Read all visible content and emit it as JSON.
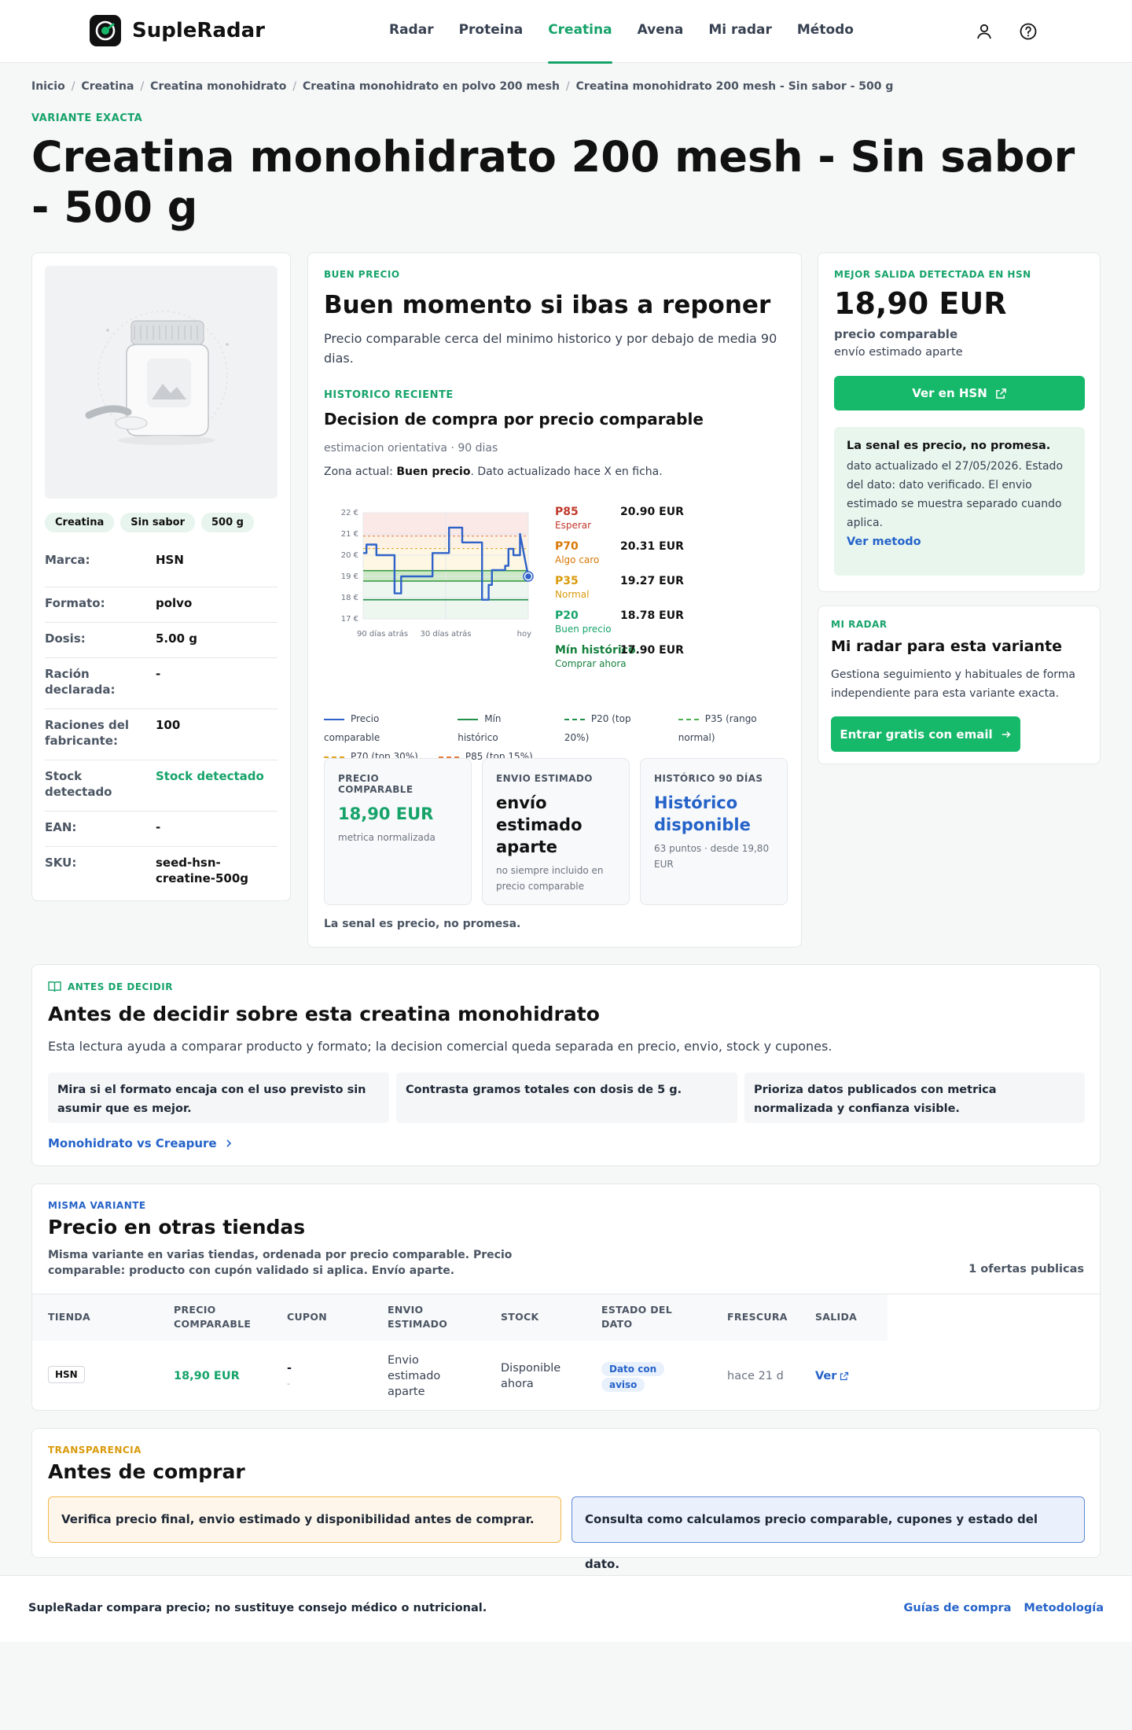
{
  "header": {
    "brand": "SupleRadar",
    "nav": [
      "Radar",
      "Proteina",
      "Creatina",
      "Avena",
      "Mi radar",
      "Método"
    ],
    "active_nav": "Creatina",
    "icons": [
      "user-icon",
      "help-icon"
    ]
  },
  "breadcrumb": [
    "Inicio",
    "Creatina",
    "Creatina monohidrato",
    "Creatina monohidrato en polvo 200 mesh",
    "Creatina monohidrato 200 mesh - Sin sabor - 500 g"
  ],
  "page": {
    "eyebrow": "VARIANTE EXACTA",
    "title": "Creatina monohidrato 200 mesh - Sin sabor - 500 g"
  },
  "product": {
    "chips": [
      "Creatina",
      "Sin sabor",
      "500 g"
    ],
    "specs": [
      {
        "k": "Marca:",
        "v": "HSN"
      },
      {
        "k": "Formato:",
        "v": "polvo"
      },
      {
        "k": "Dosis:",
        "v": "5.00 g"
      },
      {
        "k": "Ración declarada:",
        "v": "-"
      },
      {
        "k": "Raciones del fabricante:",
        "v": "100"
      },
      {
        "k": "Stock detectado",
        "v": "Stock detectado"
      },
      {
        "k": "EAN:",
        "v": "-"
      },
      {
        "k": "SKU:",
        "v": "seed-hsn-creatine-500g"
      }
    ]
  },
  "analysis": {
    "eyebrow": "BUEN PRECIO",
    "title": "Buen momento si ibas a reponer",
    "desc": "Precio comparable cerca del minimo historico y por debajo de media 90 dias.",
    "hist_eyebrow": "HISTORICO RECIENTE",
    "hist_title": "Decision de compra por precio comparable",
    "hist_meta": "estimacion orientativa · 90 dias",
    "zone_prefix": "Zona actual: ",
    "zone_value": "Buen precio",
    "zone_suffix": ". Dato actualizado hace X en ficha.",
    "footnote": "La senal es precio, no promesa.",
    "metrics": [
      {
        "label": "PRECIO COMPARABLE",
        "value": "18,90 EUR",
        "sub": "metrica normalizada"
      },
      {
        "label": "ENVIO ESTIMADO",
        "value": "envío estimado aparte",
        "sub": "no siempre incluido en precio comparable"
      },
      {
        "label": "HISTÓRICO 90 DÍAS",
        "value": "Histórico disponible",
        "sub": "63 puntos · desde 19,80 EUR"
      }
    ]
  },
  "chart_data": {
    "type": "line",
    "title": "",
    "x_ticks": [
      "90 días atrás",
      "30 días atrás",
      "hoy"
    ],
    "y_ticks": [
      "17 €",
      "18 €",
      "19 €",
      "20 €",
      "21 €",
      "22 €"
    ],
    "ylim": [
      17,
      22
    ],
    "series": [
      {
        "name": "Precio comparable",
        "color": "#2f62c9",
        "x": [
          0,
          2,
          2,
          8,
          8,
          19,
          19,
          23,
          23,
          42,
          42,
          52,
          52,
          60,
          60,
          72,
          72,
          76,
          76,
          78,
          78,
          86,
          86,
          88,
          88,
          91,
          91,
          95,
          95,
          100
        ],
        "y": [
          20.1,
          20.1,
          20.5,
          20.5,
          20.0,
          20.0,
          18.2,
          18.2,
          19.0,
          19.0,
          20.1,
          20.1,
          21.3,
          21.3,
          20.6,
          20.6,
          17.9,
          17.9,
          18.6,
          18.6,
          19.3,
          19.3,
          19.5,
          19.5,
          20.3,
          20.3,
          20.0,
          20.0,
          21.0,
          19.0
        ]
      },
      {
        "name": "Mín histórico",
        "color": "#1f8f4a",
        "value": 17.9
      },
      {
        "name": "P20 (top 20%)",
        "color": "#1f8f4a",
        "value": 18.78
      },
      {
        "name": "P35 (rango normal)",
        "color": "#4caf50",
        "value": 19.27
      },
      {
        "name": "P70 (top 30%)",
        "color": "#e0a020",
        "value": 20.31
      },
      {
        "name": "P85 (top 15%)",
        "color": "#e07a3a",
        "value": 20.9
      }
    ],
    "current_point": 19.0,
    "percentiles": [
      {
        "label": "P85",
        "note": "Esperar",
        "value": "20.90 EUR",
        "color": "#c0392b"
      },
      {
        "label": "P70",
        "note": "Algo caro",
        "value": "20.31 EUR",
        "color": "#d97706"
      },
      {
        "label": "P35",
        "note": "Normal",
        "value": "19.27 EUR",
        "color": "#d99a0b"
      },
      {
        "label": "P20",
        "note": "Buen precio",
        "value": "18.78 EUR",
        "color": "#16a36a"
      },
      {
        "label": "Mín histórico",
        "note": "Comprar ahora",
        "value": "17.90 EUR",
        "color": "#15803d"
      }
    ],
    "legend": [
      "Precio comparable",
      "Mín histórico",
      "P20 (top 20%)",
      "P35 (rango normal)",
      "P70 (top 30%)",
      "P85 (top 15%)"
    ]
  },
  "best_offer": {
    "eyebrow": "MEJOR SALIDA DETECTADA EN HSN",
    "price": "18,90 EUR",
    "label": "precio comparable",
    "shipping": "envío estimado aparte",
    "button": "Ver en HSN",
    "note_title": "La senal es precio, no promesa.",
    "note_body": "dato actualizado el 27/05/2026. Estado del dato: dato verificado. El envio estimado se muestra separado cuando aplica.",
    "note_link": "Ver metodo"
  },
  "my_radar": {
    "eyebrow": "MI RADAR",
    "title": "Mi radar para esta variante",
    "desc": "Gestiona seguimiento y habituales de forma independiente para esta variante exacta.",
    "button": "Entrar gratis con email"
  },
  "before": {
    "eyebrow": "ANTES DE DECIDIR",
    "title": "Antes de decidir sobre esta creatina monohidrato",
    "desc": "Esta lectura ayuda a comparar producto y formato; la decision comercial queda separada en precio, envio, stock y cupones.",
    "tips": [
      "Mira si el formato encaja con el uso previsto sin asumir que es mejor.",
      "Contrasta gramos totales con dosis de 5 g.",
      "Prioriza datos publicados con metrica normalizada y confianza visible."
    ],
    "link": "Monohidrato vs Creapure"
  },
  "stores": {
    "eyebrow": "MISMA VARIANTE",
    "title": "Precio en otras tiendas",
    "desc": "Misma variante en varias tiendas, ordenada por precio comparable. Precio comparable: producto con cupón validado si aplica. Envío aparte.",
    "count": "1 ofertas publicas",
    "columns": [
      "TIENDA",
      "PRECIO COMPARABLE",
      "CUPON",
      "ENVIO ESTIMADO",
      "STOCK",
      "ESTADO DEL DATO",
      "FRESCURA",
      "SALIDA"
    ],
    "rows": [
      {
        "store": "HSN",
        "price": "18,90 EUR",
        "coupon": "-",
        "coupon_sub": "-",
        "shipping": "Envio estimado aparte",
        "stock": "Disponible ahora",
        "status": "Dato con aviso",
        "freshness": "hace 21 d",
        "action": "Ver"
      }
    ]
  },
  "transparency": {
    "eyebrow": "TRANSPARENCIA",
    "title": "Antes de comprar",
    "box1": "Verifica precio final, envio estimado y disponibilidad antes de comprar.",
    "box2": "Consulta como calculamos precio comparable, cupones y estado del dato."
  },
  "footer": {
    "text": "SupleRadar compara precio; no sustituye consejo médico o nutricional.",
    "links": [
      "Guías de compra",
      "Metodología"
    ]
  }
}
